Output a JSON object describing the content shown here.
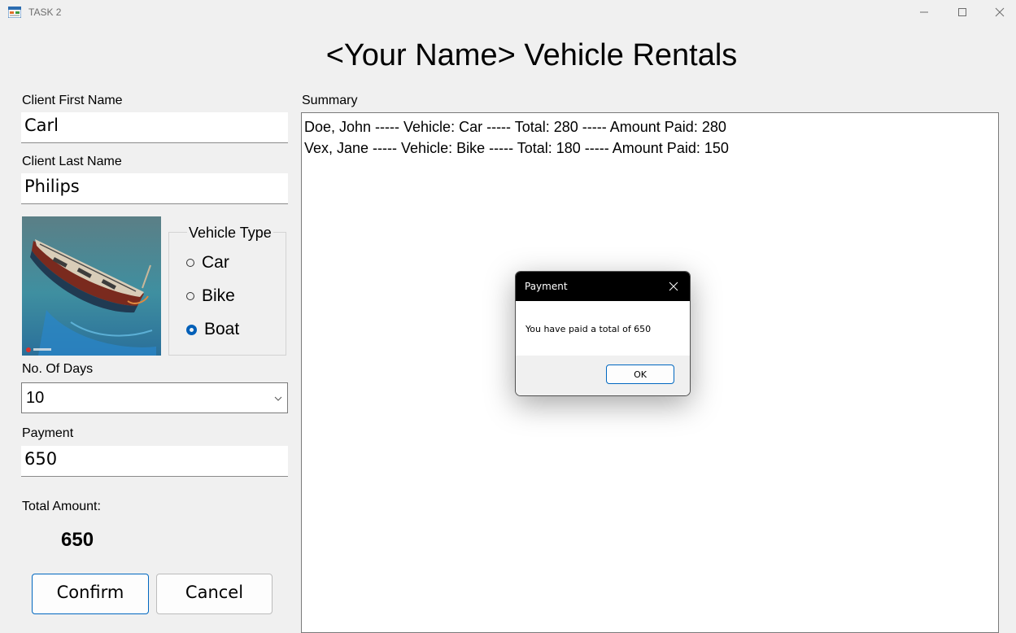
{
  "window": {
    "title": "TASK 2",
    "icon": "winforms-app-icon",
    "controls": [
      "minimize-icon",
      "maximize-icon",
      "close-icon"
    ]
  },
  "heading": "<Your Name> Vehicle Rentals",
  "form": {
    "first_name_label": "Client First Name",
    "first_name_value": "Carl",
    "last_name_label": "Client Last Name",
    "last_name_value": "Philips",
    "vehicle_image": "boat-image",
    "vehicle_type": {
      "legend": "Vehicle Type",
      "options": [
        {
          "label": "Car",
          "checked": false
        },
        {
          "label": "Bike",
          "checked": false
        },
        {
          "label": "Boat",
          "checked": true
        }
      ]
    },
    "days_label": "No. Of Days",
    "days_value": "10",
    "payment_label": "Payment",
    "payment_value": "650",
    "total_label": "Total Amount:",
    "total_value": "650",
    "confirm_label": "Confirm",
    "cancel_label": "Cancel"
  },
  "summary": {
    "label": "Summary",
    "lines": [
      "Doe, John ----- Vehicle: Car ----- Total: 280 ----- Amount Paid: 280",
      "Vex, Jane ----- Vehicle: Bike ----- Total: 180 ----- Amount Paid: 150"
    ]
  },
  "dialog": {
    "title": "Payment",
    "message": "You have paid a total of 650",
    "ok_label": "OK"
  },
  "colors": {
    "accent": "#005fb8",
    "window_bg": "#f0f0f0",
    "dialog_titlebar": "#000000"
  }
}
